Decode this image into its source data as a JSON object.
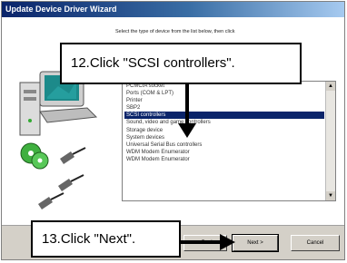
{
  "window": {
    "title": "Update Device Driver Wizard"
  },
  "instruction": "Select the type of device from the list below, then click",
  "device_list": {
    "items": [
      "PCMCIA socket",
      "Ports (COM & LPT)",
      "Printer",
      "SBP2",
      "SCSI controllers",
      "Sound, video and game controllers",
      "Storage device",
      "System devices",
      "Universal Serial Bus controllers",
      "WDM Modem Enumerator",
      "WDM Modem Enumerator"
    ],
    "selected_index": 4
  },
  "buttons": {
    "back": "< Back",
    "next": "Next >",
    "cancel": "Cancel"
  },
  "callouts": {
    "step12": "12.Click \"SCSI controllers\".",
    "step13": "13.Click \"Next\"."
  },
  "colors": {
    "title_bar": "#0a246a",
    "selection": "#0a246a",
    "dialog_face": "#d4d0c8"
  }
}
